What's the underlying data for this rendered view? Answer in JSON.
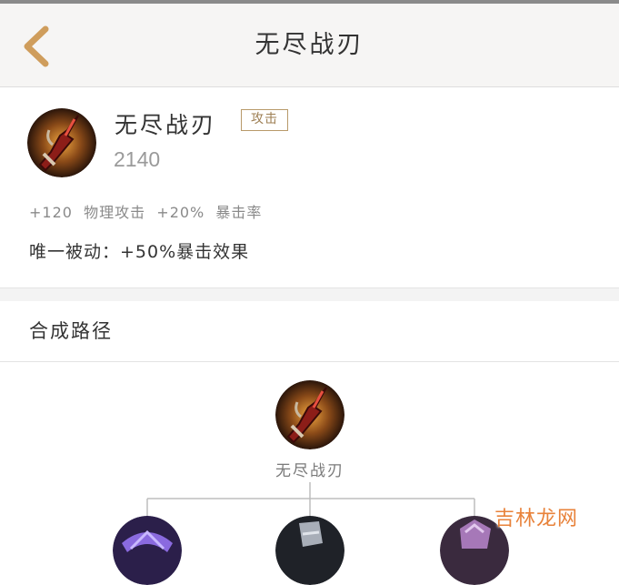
{
  "nav": {
    "title": "无尽战刃",
    "back_icon": "chevron-left-icon"
  },
  "item": {
    "name": "无尽战刃",
    "tag": "攻击",
    "price": "2140",
    "stats": "+120  物理攻击  +20%  暴击率",
    "passive": "唯一被动：+50%暴击效果",
    "icon": "infinity-blade-icon"
  },
  "synthesis": {
    "title": "合成路径",
    "root_label": "无尽战刃",
    "components": [
      {
        "icon": "purple-crystal-item-icon"
      },
      {
        "icon": "steel-blade-item-icon"
      },
      {
        "icon": "violet-armor-item-icon"
      }
    ]
  },
  "watermark": "吉林龙网",
  "colors": {
    "accent_gold": "#c89a5a",
    "tag_border": "#b89a6a",
    "navbar_bg": "#f6f5f4",
    "watermark": "#e8823a"
  }
}
